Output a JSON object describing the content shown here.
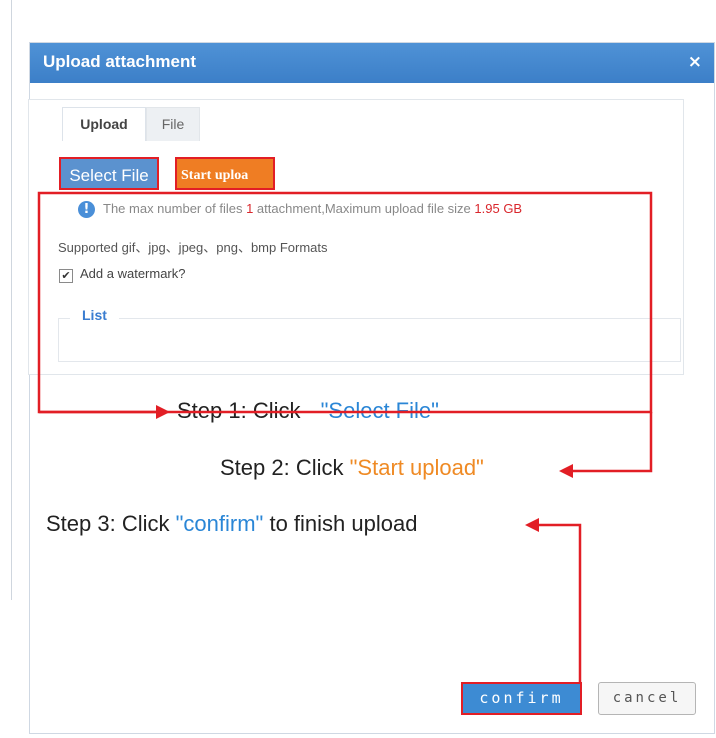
{
  "dialog": {
    "title": "Upload attachment",
    "close_glyph": "×"
  },
  "tabs": [
    {
      "label": "Upload",
      "active": true
    },
    {
      "label": "File",
      "active": false
    }
  ],
  "buttons": {
    "select_file": "Select File",
    "start_upload": "Start uploa",
    "confirm": "confirm",
    "cancel": "cancel"
  },
  "info": {
    "icon": "info-icon",
    "part1": "The max number of files ",
    "max_files": "1",
    "part2": " attachment,Maximum upload file size ",
    "max_size": "1.95 GB"
  },
  "supported_formats": "Supported gif、jpg、jpeg、png、bmp Formats",
  "watermark": {
    "label": "Add a watermark?",
    "checked": true
  },
  "list": {
    "legend": "List"
  },
  "steps": [
    {
      "lead": "Step 1: Click ",
      "highlight": "\"Select File\"",
      "tail": ""
    },
    {
      "lead": "Step 2: Click ",
      "highlight": "\"Start upload\"",
      "tail": ""
    },
    {
      "lead": "Step 3: Click ",
      "highlight": "\"confirm\"",
      "tail": " to finish upload"
    }
  ],
  "colors": {
    "titlebar": "#4488d2",
    "annotation_red": "#e21e25",
    "select_blue": "#5b92cf",
    "start_orange": "#ef7d23",
    "step_blue": "#2a86d6",
    "step_orange": "#ef8a24"
  }
}
